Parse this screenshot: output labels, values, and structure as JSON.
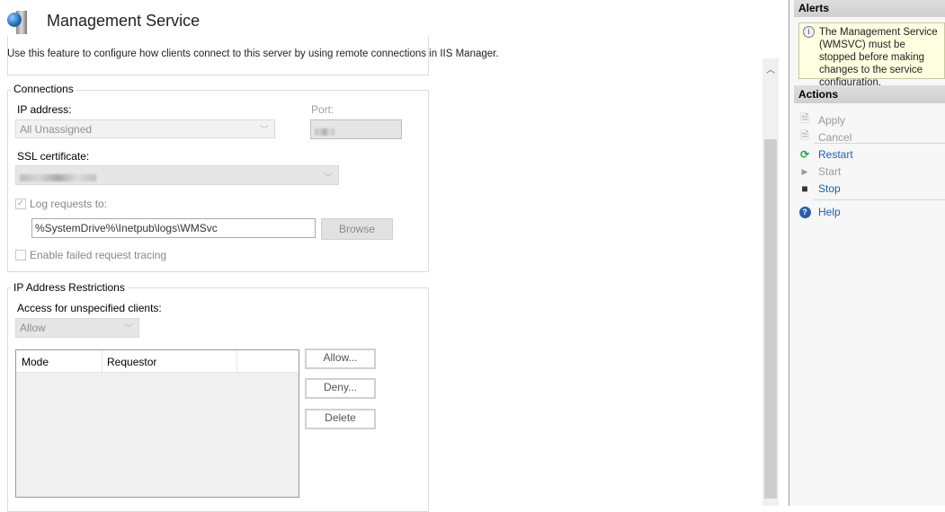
{
  "header": {
    "title": "Management Service",
    "icon": "globe-server-icon",
    "description": "Use this feature to configure how clients connect to this server by using remote connections in IIS Manager."
  },
  "connections": {
    "legend": "Connections",
    "ip_label": "IP address:",
    "ip_value": "All Unassigned",
    "port_label": "Port:",
    "ssl_label": "SSL certificate:",
    "log_label": "Log requests to:",
    "log_checked": true,
    "log_path": "%SystemDrive%\\Inetpub\\logs\\WMSvc",
    "browse": "Browse",
    "tracing_label": "Enable failed request tracing",
    "tracing_checked": false
  },
  "restrictions": {
    "legend": "IP Address Restrictions",
    "access_label": "Access for unspecified clients:",
    "access_value": "Allow",
    "columns": [
      "Mode",
      "Requestor",
      ""
    ],
    "rows": [],
    "allow": "Allow...",
    "deny": "Deny...",
    "delete": "Delete"
  },
  "alerts": {
    "title": "Alerts",
    "message": "The Management Service (WMSVC) must be stopped before making changes to the service configuration."
  },
  "actions": {
    "title": "Actions",
    "items": [
      {
        "label": "Apply",
        "icon": "apply-icon",
        "enabled": false
      },
      {
        "label": "Cancel",
        "icon": "cancel-icon",
        "enabled": false
      },
      {
        "label": "Restart",
        "icon": "restart-icon",
        "enabled": true
      },
      {
        "label": "Start",
        "icon": "start-icon",
        "enabled": false
      },
      {
        "label": "Stop",
        "icon": "stop-icon",
        "enabled": true
      },
      {
        "label": "Help",
        "icon": "help-icon",
        "enabled": true
      }
    ]
  },
  "colors": {
    "link": "#1f5fb4",
    "alert_bg": "#ffffe1"
  }
}
